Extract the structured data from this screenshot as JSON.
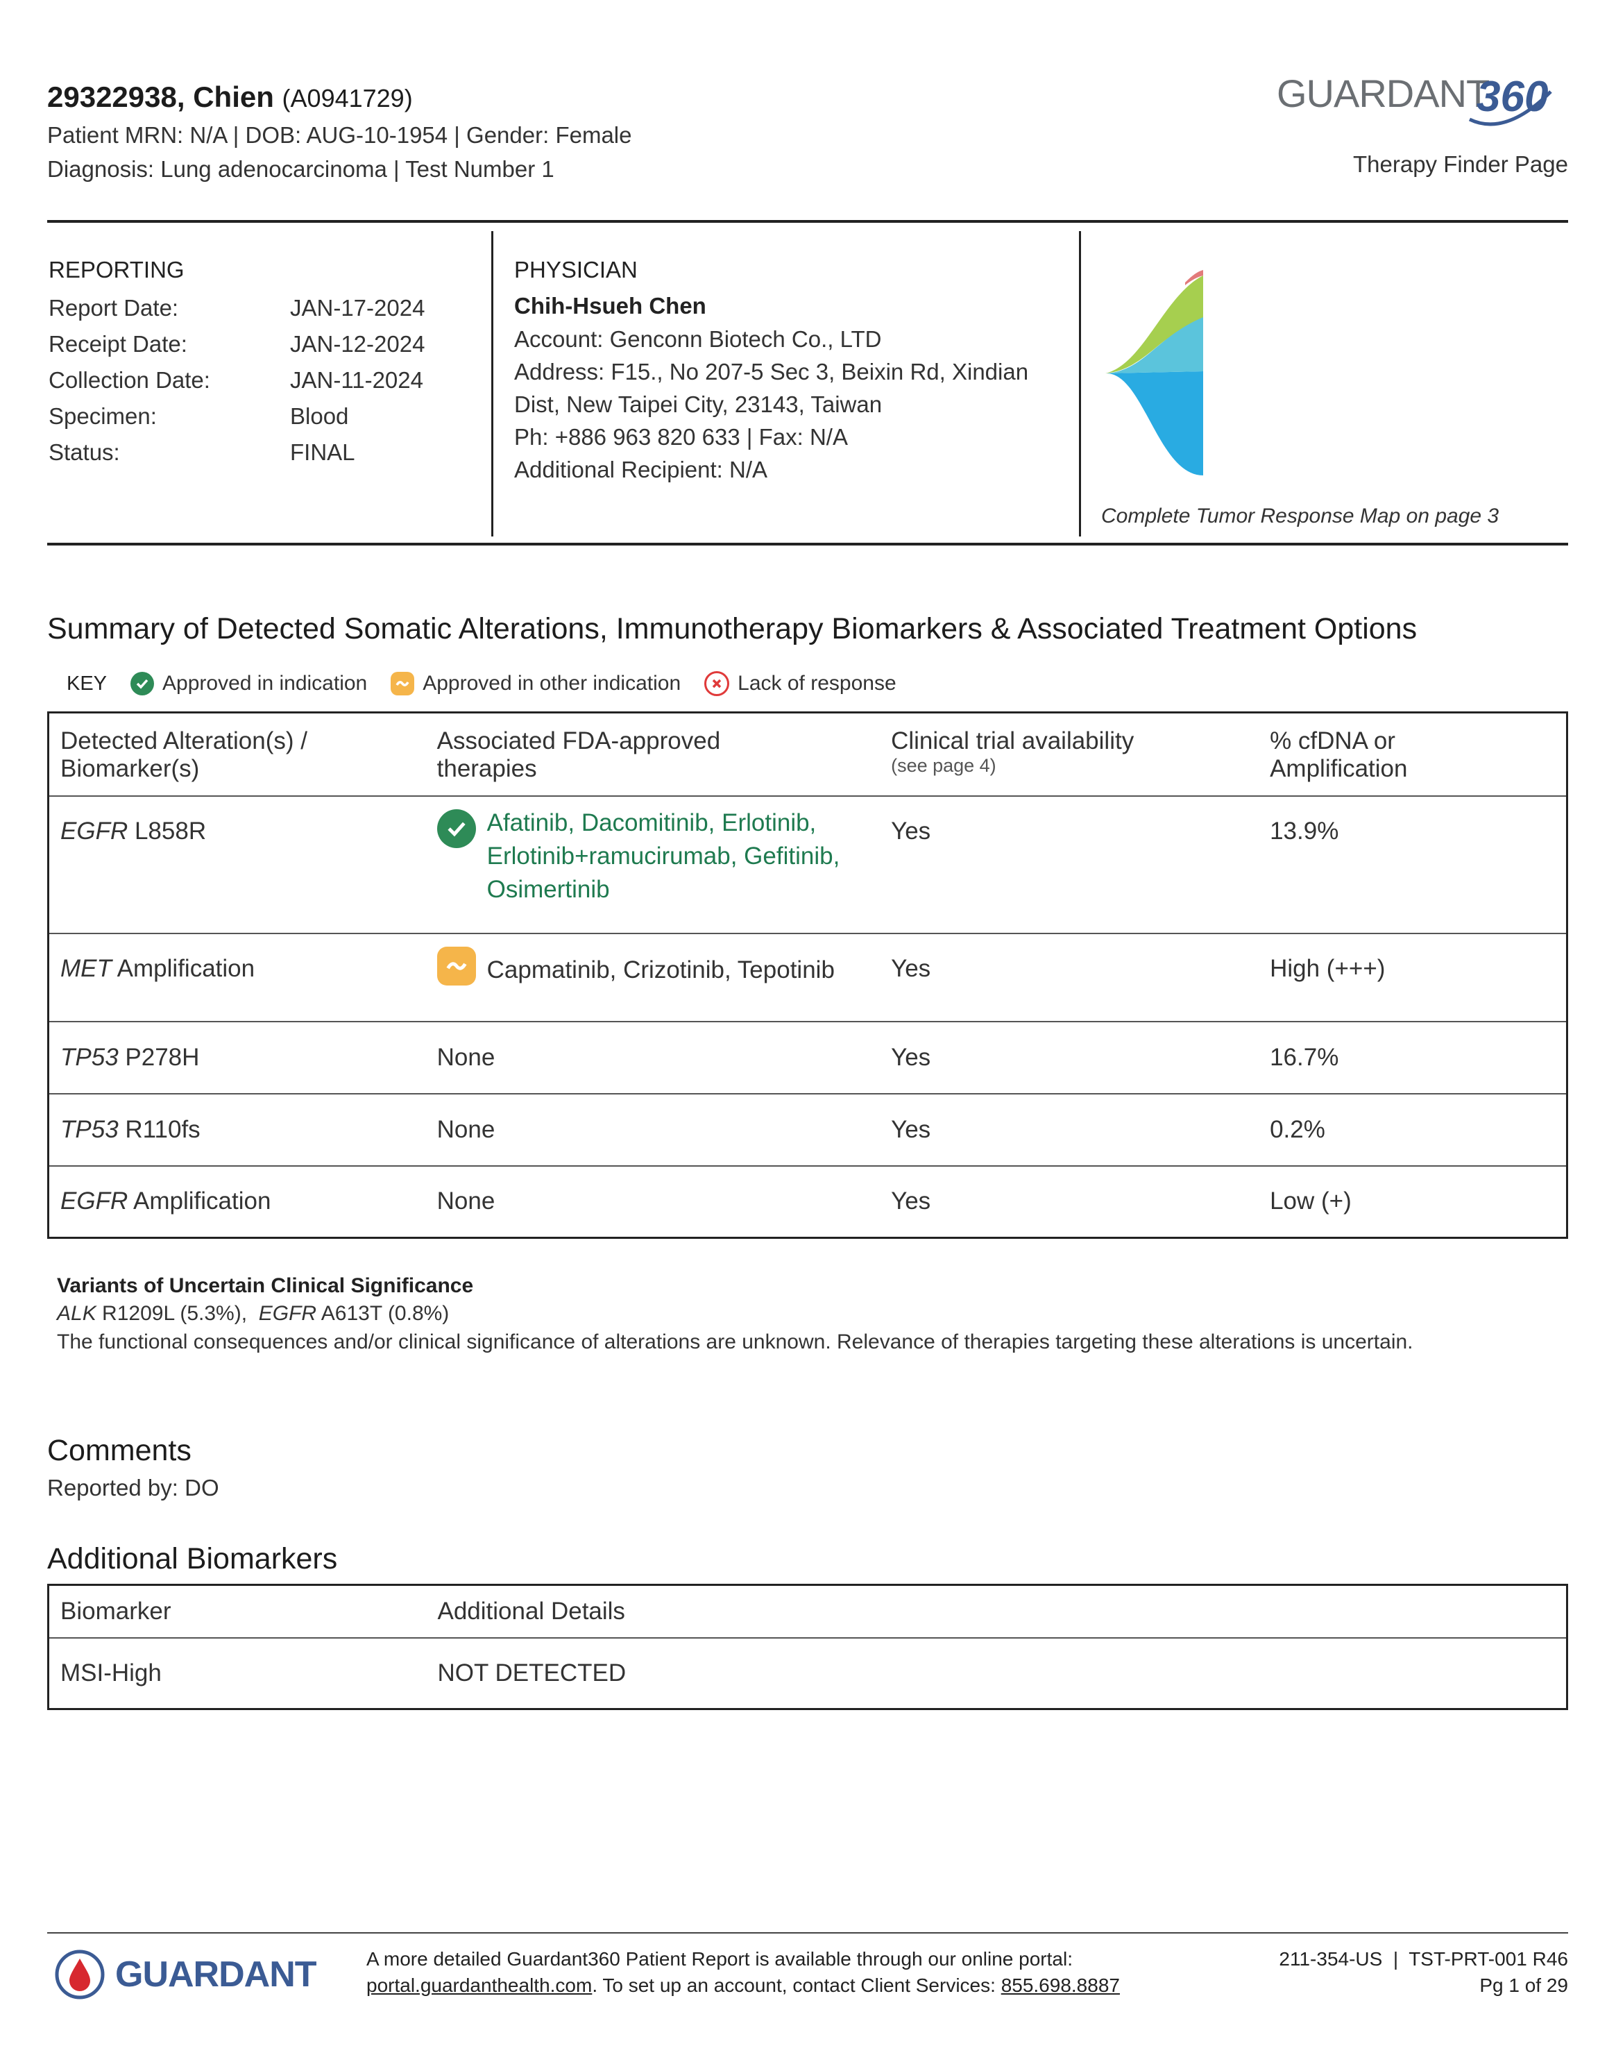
{
  "header": {
    "patient_name": "29322938, Chien",
    "accession": "(A0941729)",
    "line1": "Patient MRN: N/A | DOB: AUG-10-1954 | Gender: Female",
    "line2": "Diagnosis: Lung adenocarcinoma | Test Number 1",
    "logo_text": "GUARDANT",
    "logo_number": "360",
    "page_title": "Therapy Finder Page"
  },
  "reporting": {
    "heading": "REPORTING",
    "rows": [
      {
        "label": "Report Date:",
        "value": "JAN-17-2024"
      },
      {
        "label": "Receipt Date:",
        "value": "JAN-12-2024"
      },
      {
        "label": "Collection Date:",
        "value": "JAN-11-2024"
      },
      {
        "label": "Specimen:",
        "value": "Blood"
      },
      {
        "label": "Status:",
        "value": "FINAL"
      }
    ]
  },
  "physician": {
    "heading": "PHYSICIAN",
    "name": "Chih-Hsueh Chen",
    "account": "Account:  Genconn Biotech Co., LTD",
    "address1": "Address:  F15., No 207-5 Sec 3, Beixin Rd, Xindian",
    "address2": "Dist, New Taipei City, 23143, Taiwan",
    "phone": "Ph:  +886 963 820 633  |  Fax:  N/A",
    "additional": "Additional Recipient:  N/A"
  },
  "tumor_map": {
    "caption": "Complete Tumor Response Map on page 3",
    "colors": [
      "#29abe2",
      "#5bc4dc",
      "#a6cf4f",
      "#e27b7b"
    ]
  },
  "summary": {
    "title": "Summary of Detected Somatic Alterations, Immunotherapy Biomarkers & Associated Treatment Options",
    "key_label": "KEY",
    "key_items": [
      {
        "label": "Approved in indication",
        "icon": "check-icon",
        "color": "#2e8b57"
      },
      {
        "label": "Approved in other indication",
        "icon": "tilde-icon",
        "color": "#f5b54a"
      },
      {
        "label": "Lack of response",
        "icon": "x-icon",
        "color": "#e03a3a"
      }
    ],
    "columns": {
      "alteration": [
        "Detected Alteration(s) /",
        "Biomarker(s)"
      ],
      "therapies": [
        "Associated FDA-approved",
        "therapies"
      ],
      "trial": "Clinical trial availability",
      "trial_sub": "(see page 4)",
      "cfdna": [
        "% cfDNA or",
        "Amplification"
      ]
    },
    "rows": [
      {
        "gene": "EGFR",
        "variant": " L858R",
        "therapy_icon": "check",
        "therapy_lines": [
          "Afatinib, Dacomitinib, Erlotinib,",
          "Erlotinib+ramucirumab, Gefitinib,",
          "Osimertinib"
        ],
        "trial": "Yes",
        "cfdna": "13.9%"
      },
      {
        "gene": "MET",
        "variant": " Amplification",
        "therapy_icon": "tilde",
        "therapy_lines": [
          "Capmatinib, Crizotinib, Tepotinib"
        ],
        "trial": "Yes",
        "cfdna": "High (+++)"
      },
      {
        "gene": "TP53",
        "variant": " P278H",
        "therapy_icon": "none",
        "therapy_lines": [
          "None"
        ],
        "trial": "Yes",
        "cfdna": "16.7%"
      },
      {
        "gene": "TP53",
        "variant": " R110fs",
        "therapy_icon": "none",
        "therapy_lines": [
          "None"
        ],
        "trial": "Yes",
        "cfdna": "0.2%"
      },
      {
        "gene": "EGFR",
        "variant": " Amplification",
        "therapy_icon": "none",
        "therapy_lines": [
          "None"
        ],
        "trial": "Yes",
        "cfdna": "Low (+)"
      }
    ]
  },
  "vus": {
    "title": "Variants of Uncertain Clinical Significance",
    "gene1": "ALK",
    "var1": " R1209L (5.3%),  ",
    "gene2": "EGFR",
    "var2": " A613T (0.8%)",
    "note": "The functional consequences and/or clinical significance of alterations are unknown. Relevance of therapies targeting these alterations is uncertain."
  },
  "comments": {
    "title": "Comments",
    "reported_by": "Reported by: DO"
  },
  "additional_biomarkers": {
    "title": "Additional Biomarkers",
    "col1": "Biomarker",
    "col2": "Additional Details",
    "rows": [
      {
        "biomarker": "MSI-High",
        "details": "NOT DETECTED"
      }
    ]
  },
  "footer": {
    "logo_text": "GUARDANT",
    "line1": "A more detailed Guardant360 Patient Report is available through our online portal:",
    "portal": "portal.guardanthealth.com",
    "line2_mid": ". To set up an account, contact Client Services: ",
    "phone": "855.698.8887",
    "doc_id": "211-354-US  |  TST-PRT-001 R46",
    "page": "Pg 1 of 29"
  }
}
